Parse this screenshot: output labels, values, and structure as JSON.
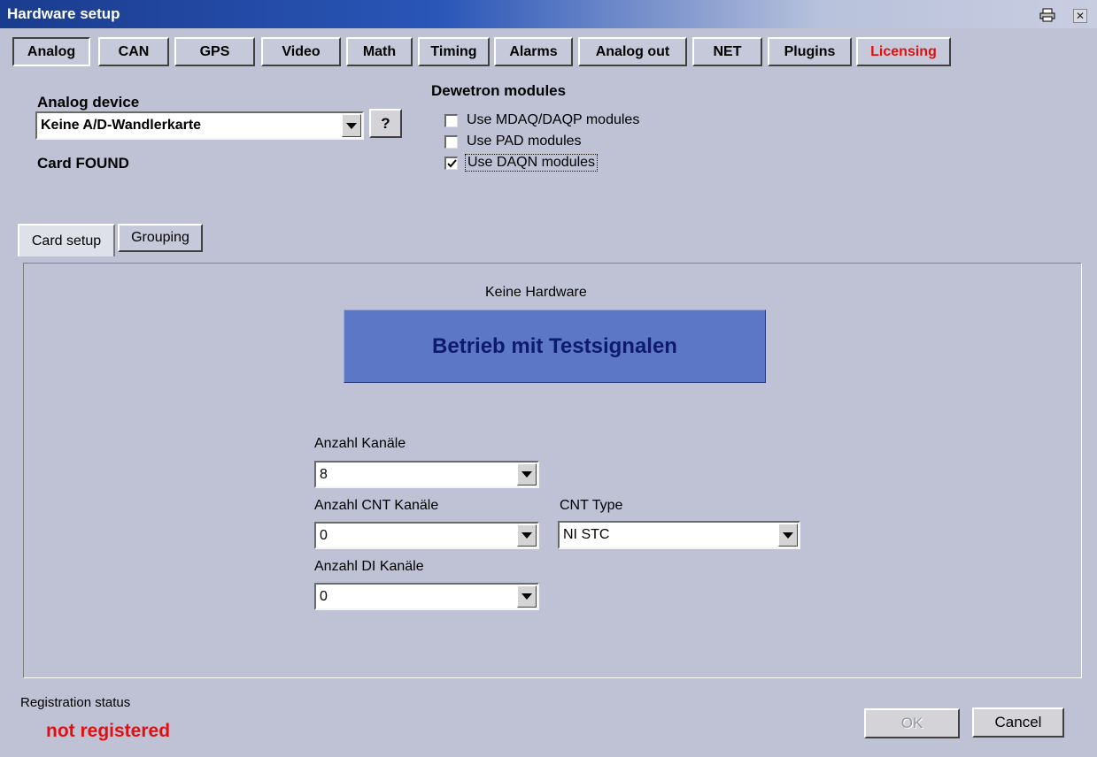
{
  "window": {
    "title": "Hardware setup",
    "print_icon": "printer-icon",
    "close_glyph": "✕"
  },
  "tabs": [
    {
      "label": "Analog",
      "active": true
    },
    {
      "label": "CAN"
    },
    {
      "label": "GPS"
    },
    {
      "label": "Video"
    },
    {
      "label": "Math"
    },
    {
      "label": "Timing"
    },
    {
      "label": "Alarms"
    },
    {
      "label": "Analog out"
    },
    {
      "label": "NET"
    },
    {
      "label": "Plugins"
    },
    {
      "label": "Licensing",
      "color": "#e01010"
    }
  ],
  "analog_device": {
    "label": "Analog device",
    "selected": "Keine A/D-Wandlerkarte",
    "help_label": "?",
    "status": "Card FOUND"
  },
  "dewetron": {
    "title": "Dewetron modules",
    "options": [
      {
        "label": "Use MDAQ/DAQP modules",
        "checked": false
      },
      {
        "label": "Use PAD modules",
        "checked": false
      },
      {
        "label": "Use DAQN modules",
        "checked": true
      }
    ]
  },
  "subtabs": [
    {
      "label": "Card setup",
      "active": true
    },
    {
      "label": "Grouping"
    }
  ],
  "card_setup": {
    "hardware_label": "Keine Hardware",
    "banner": "Betrieb mit Testsignalen",
    "banner_color": "#5b77c5",
    "channels": {
      "label": "Anzahl Kanäle",
      "value": "8"
    },
    "cnt_channels": {
      "label": "Anzahl CNT Kanäle",
      "value": "0"
    },
    "cnt_type": {
      "label": "CNT Type",
      "value": "NI STC"
    },
    "di_channels": {
      "label": "Anzahl DI Kanäle",
      "value": "0"
    }
  },
  "footer": {
    "registration_label": "Registration status",
    "registration_status": "not registered",
    "status_color": "#e01010",
    "ok_label": "OK",
    "cancel_label": "Cancel"
  }
}
